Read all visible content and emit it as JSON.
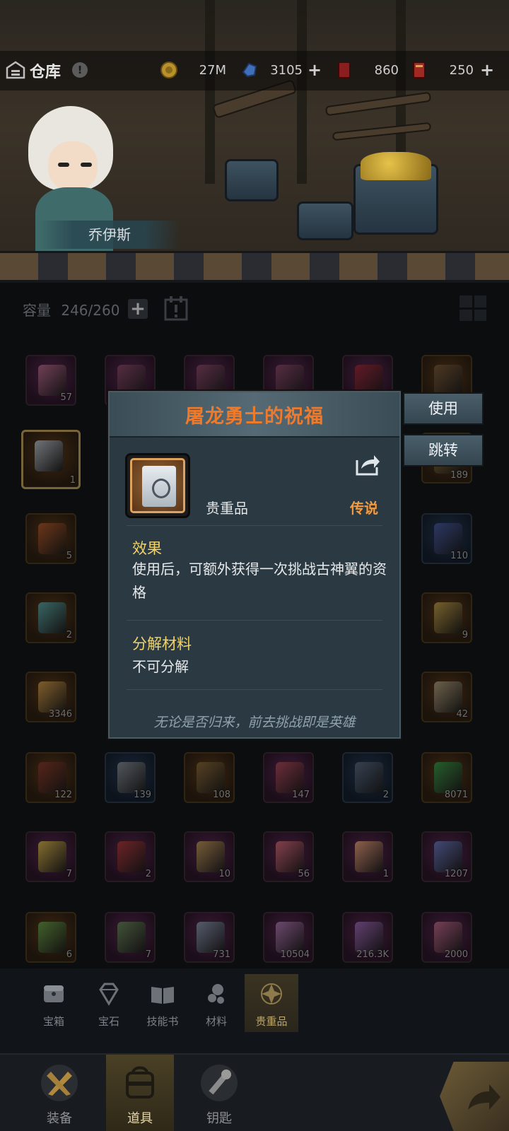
{
  "header": {
    "title": "仓库",
    "help": "!",
    "resources": [
      {
        "icon": "gold-coin-icon",
        "value": "27M"
      },
      {
        "icon": "blue-crystal-icon",
        "value": "3105"
      },
      {
        "icon": "red-card-icon",
        "value": "860"
      },
      {
        "icon": "red-ticket-icon",
        "value": "250"
      }
    ]
  },
  "hero": {
    "name": "乔伊斯"
  },
  "inventory": {
    "capacity_label": "容量",
    "capacity_value": "246/260",
    "slots": [
      {
        "count": "57",
        "rarity": "purple",
        "color": "#b86a8c"
      },
      {
        "count": "",
        "rarity": "purple",
        "color": "#8a4a6a"
      },
      {
        "count": "",
        "rarity": "purple",
        "color": "#8a4a6a"
      },
      {
        "count": "",
        "rarity": "purple",
        "color": "#8a4a6a"
      },
      {
        "count": "",
        "rarity": "purple",
        "color": "#a02a3a"
      },
      {
        "count": "",
        "rarity": "orange",
        "color": "#7a5a3a"
      },
      {
        "count": "1",
        "rarity": "orange",
        "color": "#b8c2cc",
        "selected": true
      },
      {
        "count": "189",
        "rarity": "orange",
        "color": "#9a7a3a"
      },
      {
        "count": "5",
        "rarity": "orange",
        "color": "#b0582a"
      },
      {
        "count": "110",
        "rarity": "blue",
        "color": "#4a5aa0"
      },
      {
        "count": "2",
        "rarity": "orange",
        "color": "#5aa8a8"
      },
      {
        "count": "9",
        "rarity": "orange",
        "color": "#c0a04a"
      },
      {
        "count": "3346",
        "rarity": "orange",
        "color": "#d09a4a"
      },
      {
        "count": "42",
        "rarity": "orange",
        "color": "#b0a080"
      },
      {
        "count": "122",
        "rarity": "orange",
        "color": "#8a3a2a"
      },
      {
        "count": "139",
        "rarity": "blue",
        "color": "#8a8f96"
      },
      {
        "count": "108",
        "rarity": "orange",
        "color": "#8a6a3a"
      },
      {
        "count": "147",
        "rarity": "purple",
        "color": "#b04a5a"
      },
      {
        "count": "2",
        "rarity": "blue",
        "color": "#5a6a80"
      },
      {
        "count": "8071",
        "rarity": "orange",
        "color": "#3a9a4a"
      },
      {
        "count": "7",
        "rarity": "purple",
        "color": "#d8b84a"
      },
      {
        "count": "2",
        "rarity": "purple",
        "color": "#b03a3a"
      },
      {
        "count": "10",
        "rarity": "purple",
        "color": "#c09a5a"
      },
      {
        "count": "56",
        "rarity": "purple",
        "color": "#d86a7a"
      },
      {
        "count": "1",
        "rarity": "purple",
        "color": "#e8a07a"
      },
      {
        "count": "1207",
        "rarity": "purple",
        "color": "#6a7ac0"
      },
      {
        "count": "6",
        "rarity": "orange",
        "color": "#6aa04a"
      },
      {
        "count": "7",
        "rarity": "purple",
        "color": "#6a8a5a"
      },
      {
        "count": "731",
        "rarity": "purple",
        "color": "#8a9ab0"
      },
      {
        "count": "10504",
        "rarity": "purple",
        "color": "#b07ab0"
      },
      {
        "count": "216.3K",
        "rarity": "purple",
        "color": "#a06ab8"
      },
      {
        "count": "2000",
        "rarity": "purple",
        "color": "#c06a8a"
      }
    ]
  },
  "popup": {
    "title": "屠龙勇士的祝福",
    "type": "贵重品",
    "rarity": "传说",
    "effect_title": "效果",
    "effect_text": "使用后，可额外获得一次挑战古神翼的资格",
    "decompose_title": "分解材料",
    "decompose_text": "不可分解",
    "flavor": "无论是否归来，前去挑战即是英雄",
    "use_label": "使用",
    "jump_label": "跳转"
  },
  "categories": [
    {
      "label": "宝箱",
      "icon": "chest-icon"
    },
    {
      "label": "宝石",
      "icon": "gem-icon"
    },
    {
      "label": "技能书",
      "icon": "book-icon"
    },
    {
      "label": "材料",
      "icon": "material-icon"
    },
    {
      "label": "贵重品",
      "icon": "valuable-icon",
      "active": true
    }
  ],
  "nav": [
    {
      "label": "装备",
      "icon": "equipment-icon"
    },
    {
      "label": "道具",
      "icon": "item-bag-icon",
      "active": true
    },
    {
      "label": "钥匙",
      "icon": "key-icon"
    }
  ],
  "colors": {
    "title_orange": "#f07a2a",
    "legend": "#f29a3e",
    "section_gold": "#f0d36b"
  }
}
